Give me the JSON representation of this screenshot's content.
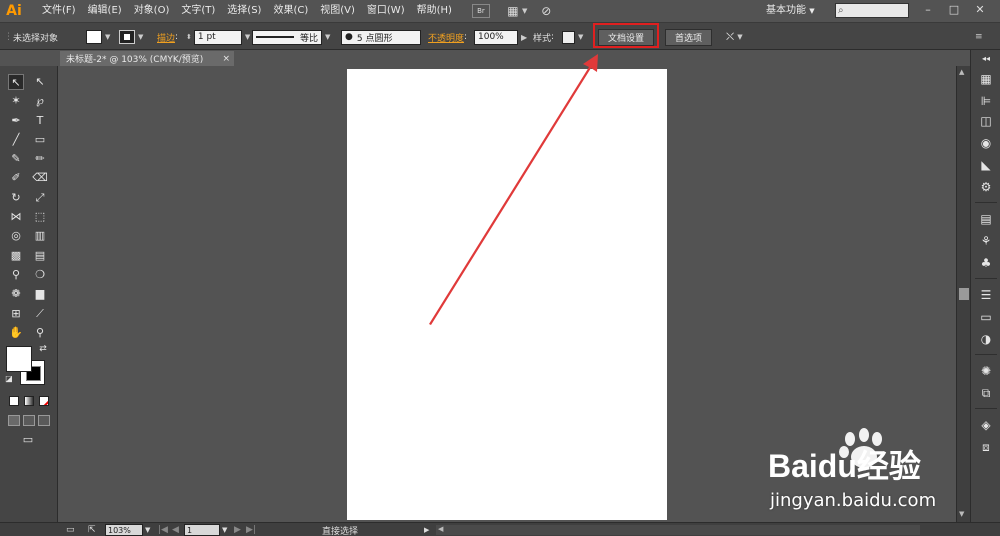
{
  "app": {
    "logo": "Ai"
  },
  "menubar": {
    "items": [
      "文件(F)",
      "编辑(E)",
      "对象(O)",
      "文字(T)",
      "选择(S)",
      "效果(C)",
      "视图(V)",
      "窗口(W)",
      "帮助(H)"
    ],
    "bridge_label": "Br",
    "workspace": "基本功能",
    "search_placeholder": ""
  },
  "controlbar": {
    "selection_status": "未选择对象",
    "stroke_label": "描边",
    "stroke_weight": "1 pt",
    "stroke_style": "等比",
    "brush_size": "5 点圆形",
    "opacity_label": "不透明度",
    "opacity_value": "100%",
    "style_label": "样式",
    "doc_setup_button": "文档设置",
    "preferences_button": "首选项"
  },
  "document_tab": {
    "title": "未标题-2* @ 103% (CMYK/预览)",
    "close": "×"
  },
  "statusbar": {
    "zoom": "103%",
    "artboard_number": "1",
    "current_tool": "直接选择"
  },
  "watermark": {
    "brand": "Baidu经验",
    "url": "jingyan.baidu.com"
  },
  "colors": {
    "ui_bg": "#535353",
    "panel_bg": "#454545",
    "accent_orange": "#f0a020",
    "highlight_red": "#e02020"
  }
}
